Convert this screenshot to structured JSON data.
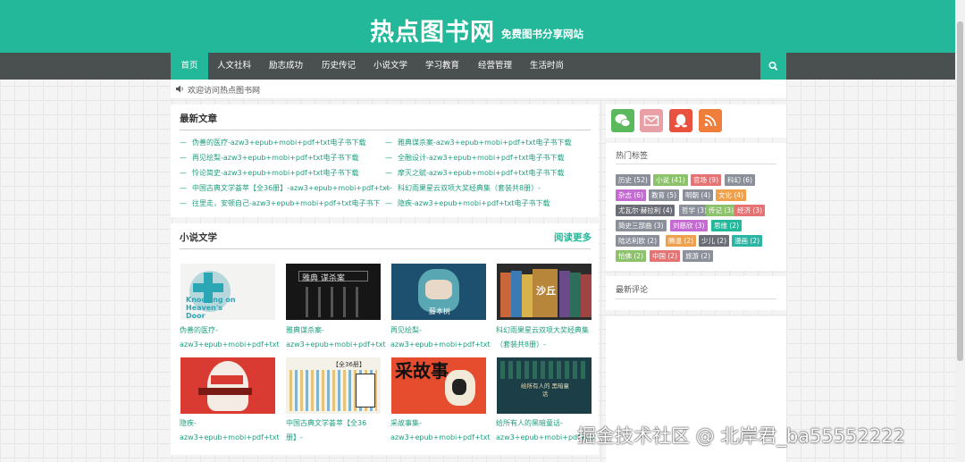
{
  "header": {
    "title": "热点图书网",
    "slogan": "免费图书分享网站"
  },
  "nav": {
    "items": [
      {
        "label": "首页",
        "active": true
      },
      {
        "label": "人文社科"
      },
      {
        "label": "励志成功"
      },
      {
        "label": "历史传记"
      },
      {
        "label": "小说文学"
      },
      {
        "label": "学习教育"
      },
      {
        "label": "经营管理"
      },
      {
        "label": "生活时尚"
      }
    ],
    "search_icon": "search-icon"
  },
  "notice": {
    "icon": "speaker-icon",
    "text": "欢迎访问热点图书网"
  },
  "latest": {
    "title": "最新文章",
    "articles": [
      "伪善的医疗-azw3+epub+mobi+pdf+txt电子书下载",
      "雅典谋杀案-azw3+epub+mobi+pdf+txt电子书下载",
      "再见绘梨-azw3+epub+mobi+pdf+txt电子书下载",
      "全融设计-azw3+epub+mobi+pdf+txt电子书下载",
      "怜论简史-azw3+epub+mobi+pdf+txt电子书下载",
      "摩灭之赋-azw3+epub+mobi+pdf+txt电子书下载",
      "中国古典文学荟萃【全36册】-azw3+epub+mobi+pdf+txt",
      "科幻雨果星云双项大奖经典集（套装共8册）-",
      "往里走，安顿自己-azw3+epub+mobi+pdf+txt电子书下",
      "隐疾-azw3+epub+mobi+pdf+txt电子书下载"
    ]
  },
  "fiction": {
    "title": "小说文学",
    "more": "阅读更多",
    "books": [
      {
        "line1": "伪善的医疗-",
        "line2": "azw3+epub+mobi+pdf+txt",
        "cover_text": "Knocking on Heaven's Door"
      },
      {
        "line1": "雅典谋杀案-",
        "line2": "azw3+epub+mobi+pdf+txt",
        "cover_text": "雅典 谋杀案"
      },
      {
        "line1": "再见绘梨-",
        "line2": "azw3+epub+mobi+pdf+txt",
        "cover_text": "藤本树"
      },
      {
        "line1": "科幻雨果星云双项大奖经典集",
        "line2": "（套装共8册）-",
        "cover_text": "沙丘"
      },
      {
        "line1": "隐疾-",
        "line2": "azw3+epub+mobi+pdf+txt",
        "cover_text": ""
      },
      {
        "line1": "中国古典文学荟萃【全36",
        "line2": "册】-",
        "cover_text": "【全36册】"
      },
      {
        "line1": "采故事集-",
        "line2": "azw3+epub+mobi+pdf+txt",
        "cover_text": "采故事"
      },
      {
        "line1": "给所有人的黑暗童话-",
        "line2": "azw3+epub+mobi+pdf+txt",
        "cover_text": "给所有人的 黑暗童话"
      }
    ]
  },
  "sidebar": {
    "social": [
      {
        "icon": "wechat-icon",
        "color": "#5cb85c"
      },
      {
        "icon": "mail-icon",
        "color": "#e8a0a6"
      },
      {
        "icon": "qq-icon",
        "color": "#e8523f"
      },
      {
        "icon": "rss-icon",
        "color": "#ef7d3b"
      }
    ],
    "tags_title": "热门标签",
    "tags": [
      {
        "label": "历史 (52)",
        "color": "#8a8f9a"
      },
      {
        "label": "小说 (41)",
        "color": "#8cc26b"
      },
      {
        "label": "官场 (9)",
        "color": "#e57373"
      },
      {
        "label": "科幻 (6)",
        "color": "#8a8f9a"
      },
      {
        "label": "杂志 (6)",
        "color": "#c46bd1"
      },
      {
        "label": "教育 (5)",
        "color": "#8a8f9a"
      },
      {
        "label": "明朝 (4)",
        "color": "#8a8f9a"
      },
      {
        "label": "文化 (4)",
        "color": "#f0a04b"
      },
      {
        "label": "尤瓦尔·赫拉利 (4)",
        "color": "#6b6e76"
      },
      {
        "label": "哲学 (3)",
        "color": "#8a8f9a"
      },
      {
        "label": "传记 (3)",
        "color": "#8cc26b"
      },
      {
        "label": "经济 (3)",
        "color": "#e57373"
      },
      {
        "label": "简史三部曲 (3)",
        "color": "#8a8f9a"
      },
      {
        "label": "刘慈欣 (3)",
        "color": "#c46bd1"
      },
      {
        "label": "思维 (2)",
        "color": "#24b89a"
      },
      {
        "label": "陆达利欧 (2)",
        "color": "#8a8f9a"
      },
      {
        "label": "腾温 (2)",
        "color": "#f0a04b"
      },
      {
        "label": "少儿 (2)",
        "color": "#6b6e76"
      },
      {
        "label": "漫画 (2)",
        "color": "#2bb5a5"
      },
      {
        "label": "恰佛 (2)",
        "color": "#8cc26b"
      },
      {
        "label": "中国 (2)",
        "color": "#e57373"
      },
      {
        "label": "旅游 (2)",
        "color": "#8a8f9a"
      }
    ],
    "comments_title": "最新评论"
  },
  "watermark": "掘金技术社区 @ 北岸君_ba55552222",
  "colors": {
    "brand": "#24b89a",
    "nav_bg": "#4a4f4f",
    "link": "#1e9e7e"
  }
}
